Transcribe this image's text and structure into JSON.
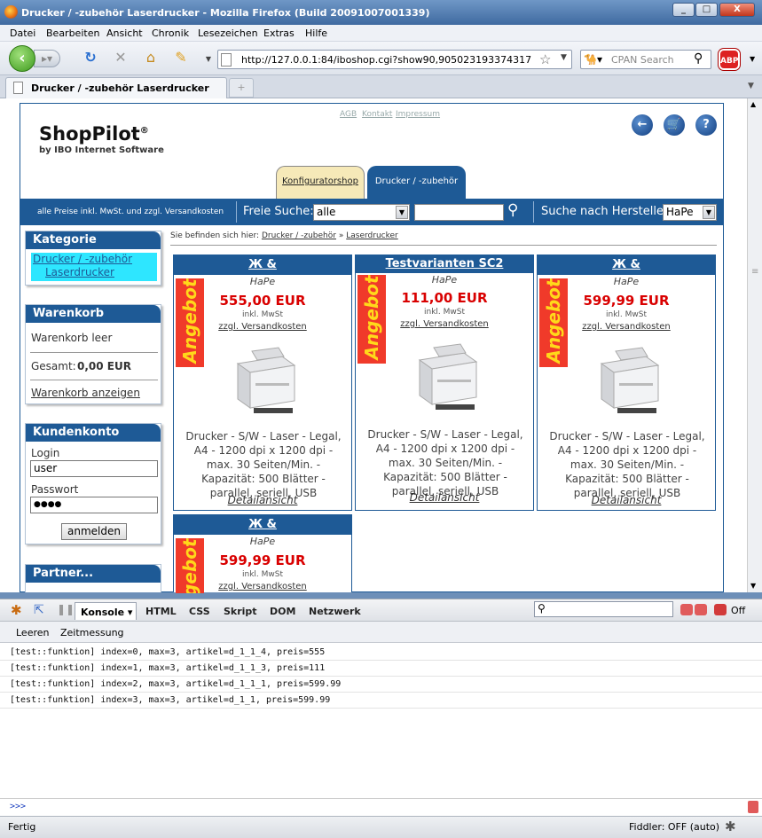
{
  "window": {
    "title": "Drucker / -zubehör Laserdrucker - Mozilla Firefox (Build 20091007001339)",
    "min": "_",
    "max": "□",
    "close": "X"
  },
  "menu": [
    "Datei",
    "Bearbeiten",
    "Ansicht",
    "Chronik",
    "Lesezeichen",
    "Extras",
    "Hilfe"
  ],
  "nav": {
    "url": "http://127.0.0.1:84/iboshop.cgi?show90,905023193374317",
    "search_placeholder": "CPAN Search",
    "abp": "ABP"
  },
  "tab": {
    "title": "Drucker / -zubehör Laserdrucker",
    "new_tab": "+"
  },
  "shop": {
    "logo": "ShopPilot",
    "logo_reg": "®",
    "logo_sub": "by IBO Internet Software",
    "links": [
      "AGB",
      "Kontakt",
      "Impressum"
    ],
    "tabs": [
      "Konfiguratorshop",
      "Drucker / -zubehör"
    ],
    "price_note": "alle Preise inkl. MwSt. und zzgl. Versandkosten",
    "search_label": "Freie Suche:",
    "search_select": "alle",
    "search_input": "",
    "mfr_label": "Suche nach Hersteller:",
    "mfr_select": "HaPe",
    "breadcrumb_prefix": "Sie befinden sich hier:",
    "breadcrumb": [
      "Drucker / -zubehör",
      "Laserdrucker"
    ],
    "breadcrumb_sep": "»"
  },
  "sidebar": {
    "kategorie": {
      "title": "Kategorie",
      "item1": "Drucker / -zubehör",
      "item2": "Laserdrucker"
    },
    "warenkorb": {
      "title": "Warenkorb",
      "empty": "Warenkorb leer",
      "total_label": "Gesamt:",
      "total": "0,00 EUR",
      "show": "Warenkorb anzeigen"
    },
    "konto": {
      "title": "Kundenkonto",
      "login_label": "Login",
      "login_value": "user",
      "pw_label": "Passwort",
      "pw_value": "●●●●",
      "button": "anmelden"
    },
    "partner": {
      "title": "Partner..."
    }
  },
  "products": [
    {
      "title": "Ж &",
      "mfr": "HaPe",
      "badge": "Angebot",
      "price": "555,00 EUR",
      "mwst": "inkl. MwSt",
      "shipping": "zzgl. Versandkosten",
      "desc": "Drucker - S/W - Laser - Legal, A4 - 1200 dpi x 1200 dpi - max. 30 Seiten/Min. - Kapazität: 500 Blätter - parallel, seriell, USB",
      "detail": "Detailansicht"
    },
    {
      "title": "Testvarianten SC2",
      "mfr": "HaPe",
      "badge": "Angebot",
      "price": "111,00 EUR",
      "mwst": "inkl. MwSt",
      "shipping": "zzgl. Versandkosten",
      "desc": "Drucker - S/W - Laser - Legal, A4 - 1200 dpi x 1200 dpi - max. 30 Seiten/Min. - Kapazität: 500 Blätter - parallel, seriell, USB",
      "detail": "Detailansicht"
    },
    {
      "title": "Ж &",
      "mfr": "HaPe",
      "badge": "Angebot",
      "price": "599,99 EUR",
      "mwst": "inkl. MwSt",
      "shipping": "zzgl. Versandkosten",
      "desc": "Drucker - S/W - Laser - Legal, A4 - 1200 dpi x 1200 dpi - max. 30 Seiten/Min. - Kapazität: 500 Blätter - parallel, seriell, USB",
      "detail": "Detailansicht"
    },
    {
      "title": "Ж &",
      "mfr": "HaPe",
      "badge": "Angebot",
      "price": "599,99 EUR",
      "mwst": "inkl. MwSt",
      "shipping": "zzgl. Versandkosten"
    }
  ],
  "firebug": {
    "tabs": [
      "Konsole ▾",
      "HTML",
      "CSS",
      "Skript",
      "DOM",
      "Netzwerk"
    ],
    "sub": [
      "Leeren",
      "Zeitmessung"
    ],
    "off": "Off",
    "lines": [
      "[test::funktion] index=0, max=3, artikel=d_1_1_4, preis=555",
      "[test::funktion] index=1, max=3, artikel=d_1_1_3, preis=111",
      "[test::funktion] index=2, max=3, artikel=d_1_1_1, preis=599.99",
      "[test::funktion] index=3, max=3, artikel=d_1_1, preis=599.99"
    ],
    "prompt": ">>>"
  },
  "status": {
    "left": "Fertig",
    "right": "Fiddler: OFF (auto)"
  }
}
